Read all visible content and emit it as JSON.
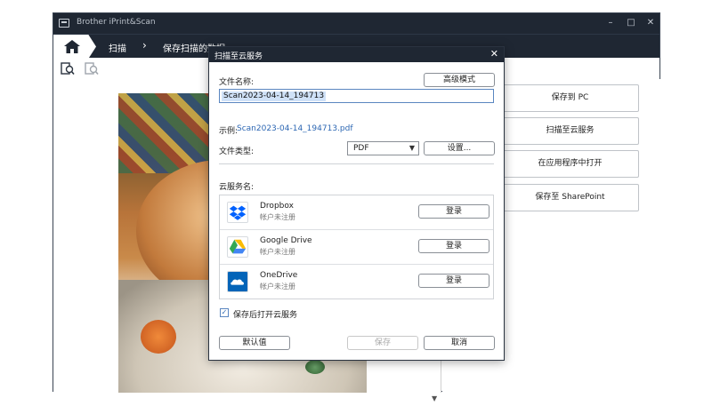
{
  "app": {
    "title": "Brother iPrint&Scan",
    "window_controls": {
      "minimize": "–",
      "maximize": "□",
      "close": "✕"
    }
  },
  "nav": {
    "home_icon": "home-icon",
    "breadcrumbs": [
      "扫描",
      "保存扫描的数据"
    ],
    "separator": "›"
  },
  "toolbar": {
    "icons": [
      "zoom-fit-icon",
      "zoom-page-icon"
    ]
  },
  "right_panel": {
    "buttons": [
      "保存到 PC",
      "扫描至云服务",
      "在应用程序中打开",
      "保存至 SharePoint"
    ]
  },
  "dialog": {
    "title": "扫描至云服务",
    "close": "✕",
    "filename_label": "文件名称:",
    "advanced_button": "高级模式",
    "filename_value": "Scan2023-04-14_194713",
    "example_prefix": "示例:",
    "example_file": "Scan2023-04-14_194713.pdf",
    "filetype_label": "文件类型:",
    "filetype_value": "PDF",
    "settings_button": "设置...",
    "services_label": "云服务名:",
    "services": [
      {
        "name": "Dropbox",
        "status": "帐户未注册",
        "button": "登录",
        "icon": "dropbox-icon",
        "color": "#0061fe"
      },
      {
        "name": "Google Drive",
        "status": "帐户未注册",
        "button": "登录",
        "icon": "google-drive-icon",
        "color": "#34a853"
      },
      {
        "name": "OneDrive",
        "status": "帐户未注册",
        "button": "登录",
        "icon": "onedrive-icon",
        "color": "#0364b8"
      }
    ],
    "open_after_save_label": "保存后打开云服务",
    "open_after_save_checked": true,
    "default_button": "默认值",
    "save_button": "保存",
    "cancel_button": "取消"
  },
  "colors": {
    "titlebar": "#1f2733",
    "link": "#2d67b3",
    "selection": "#cfe1f7"
  }
}
